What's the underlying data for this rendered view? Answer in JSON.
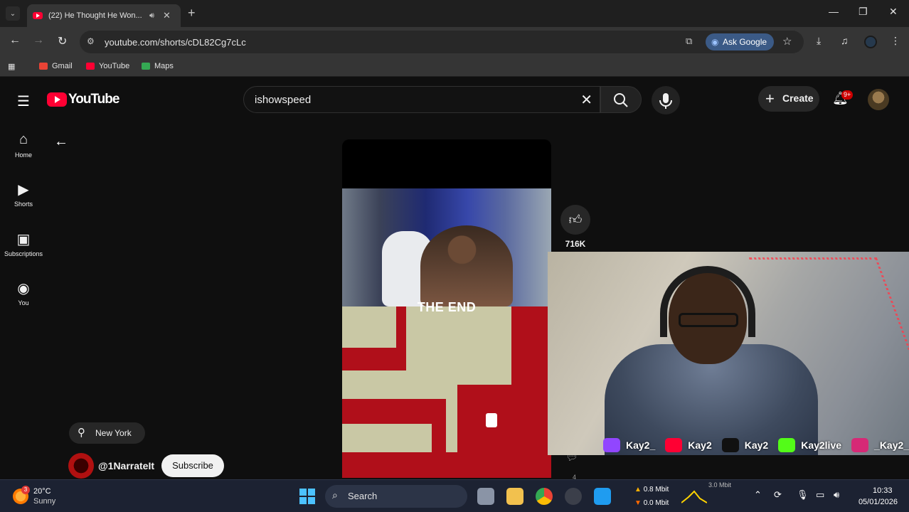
{
  "browser": {
    "tab": {
      "title": "(22) He Thought He Won...",
      "audio_icon": "speaker-icon",
      "close": "✕"
    },
    "new_tab": "+",
    "window_controls": {
      "minimize": "—",
      "maximize": "❐",
      "close": "✕"
    },
    "url": "youtube.com/shorts/cDL82Cg7cLc",
    "ask_google_label": "Ask Google",
    "bookmarks": [
      {
        "label": "Gmail",
        "color": "#ea4335"
      },
      {
        "label": "YouTube",
        "color": "#ff0033"
      },
      {
        "label": "Maps",
        "color": "#34a853"
      }
    ]
  },
  "youtube": {
    "logo_text": "YouTube",
    "search_query": "ishowspeed",
    "create_label": "Create",
    "notifications_badge": "9+",
    "guide": [
      {
        "label": "Home",
        "icon": "home-icon"
      },
      {
        "label": "Shorts",
        "icon": "shorts-icon"
      },
      {
        "label": "Subscriptions",
        "icon": "subscriptions-icon"
      },
      {
        "label": "You",
        "icon": "you-icon"
      }
    ],
    "short": {
      "overlay_text": "THE END",
      "like_count": "716K",
      "comment_count": "4",
      "location": "New York",
      "channel": "@1NarrateIt",
      "subscribe_label": "Subscribe"
    }
  },
  "stream_overlay": {
    "socials": [
      {
        "platform": "twitch",
        "handle": "Kay2_",
        "color": "#9146ff"
      },
      {
        "platform": "youtube",
        "handle": "Kay2",
        "color": "#ff0033"
      },
      {
        "platform": "tiktok",
        "handle": "Kay2",
        "color": "#111111"
      },
      {
        "platform": "kick",
        "handle": "Kay2live",
        "color": "#53fc18"
      },
      {
        "platform": "instagram",
        "handle": "_Kay2_",
        "color": "#d62976"
      }
    ]
  },
  "taskbar": {
    "weather_badge": "3",
    "temperature": "20°C",
    "condition": "Sunny",
    "search_label": "Search",
    "net_up": "0.8 Mbit",
    "net_down": "0.0 Mbit",
    "net_max": "3.0 Mbit",
    "time": "10:33",
    "date": "05/01/2026"
  }
}
